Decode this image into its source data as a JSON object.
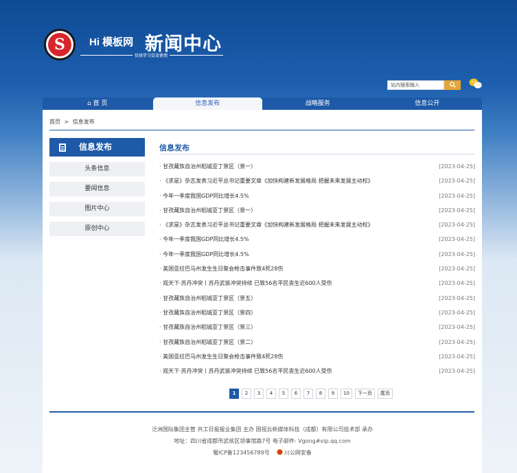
{
  "header": {
    "logo_letter": "S",
    "brand": "Hi 模板网",
    "brand_sub": "仅供学习交流使用",
    "title": "新闻中心",
    "search_placeholder": "站内搜索输入",
    "search_icon": "search-icon",
    "wechat_icon": "wechat-icon"
  },
  "nav": [
    {
      "label": "首 页",
      "icon": "home-icon"
    },
    {
      "label": "信息发布"
    },
    {
      "label": "战略服务"
    },
    {
      "label": "信息公开"
    }
  ],
  "breadcrumb": {
    "home": "首页",
    "sep": ">",
    "current": "信息发布"
  },
  "sidebar": {
    "title": "信息发布",
    "items": [
      "头条信息",
      "要闻信息",
      "图片中心",
      "原创中心"
    ]
  },
  "main": {
    "title": "信息发布",
    "news": [
      {
        "title": "· 甘孜藏族自治州稻城亚丁景区（景一）",
        "date": "[2023-04-25]"
      },
      {
        "title": "· 《求是》杂志发表习近平总书记重要文章《加快构建新发展格局 把握未来发展主动权》",
        "date": "[2023-04-25]"
      },
      {
        "title": "· 今年一季度我国GDP同比增长4.5%",
        "date": "[2023-04-25]"
      },
      {
        "title": "· 甘孜藏族自治州稻城亚丁景区（景一）",
        "date": "[2023-04-25]"
      },
      {
        "title": "· 《求是》杂志发表习近平总书记重要文章《加快构建新发展格局 把握未来发展主动权》",
        "date": "[2023-04-25]"
      },
      {
        "title": "· 今年一季度我国GDP同比增长4.5%",
        "date": "[2023-04-25]"
      },
      {
        "title": "· 今年一季度我国GDP同比增长4.5%",
        "date": "[2023-04-25]"
      },
      {
        "title": "· 美国亚拉巴马州发生生日聚会枪击事件致4死28伤",
        "date": "[2023-04-25]"
      },
      {
        "title": "· 观天下·苏丹冲突丨苏丹武装冲突持续 已致56名平民丧生近600人受伤",
        "date": "[2023-04-25]"
      },
      {
        "title": "· 甘孜藏族自治州稻城亚丁景区（景五）",
        "date": "[2023-04-25]"
      },
      {
        "title": "· 甘孜藏族自治州稻城亚丁景区（景四）",
        "date": "[2023-04-25]"
      },
      {
        "title": "· 甘孜藏族自治州稻城亚丁景区（景三）",
        "date": "[2023-04-25]"
      },
      {
        "title": "· 甘孜藏族自治州稻城亚丁景区（景二）",
        "date": "[2023-04-25]"
      },
      {
        "title": "· 美国亚拉巴马州发生生日聚会枪击事件致4死28伤",
        "date": "[2023-04-25]"
      },
      {
        "title": "· 观天下·苏丹冲突丨苏丹武装冲突持续 已致56名平民丧生近600人受伤",
        "date": "[2023-04-25]"
      }
    ]
  },
  "pager": {
    "pages": [
      "1",
      "2",
      "3",
      "4",
      "5",
      "6",
      "7",
      "8",
      "9",
      "10"
    ],
    "current": "1",
    "next": "下一页",
    "last": "尾页"
  },
  "footer": {
    "line1": "泛洲国际集团主管   共工日报报业集团 主办   国视云新媒体科技（成都）有限公司技术部 承办",
    "line2": "地址：四川省成都市武侯区领事馆路7号   电子邮件: Vgong#vip.qq.com",
    "icp": "蜀ICP备123456789号",
    "police": "川公网安备"
  },
  "colors": {
    "primary": "#1e5aa8",
    "search_btn": "#e6a63b",
    "logo_red": "#d8252b"
  }
}
